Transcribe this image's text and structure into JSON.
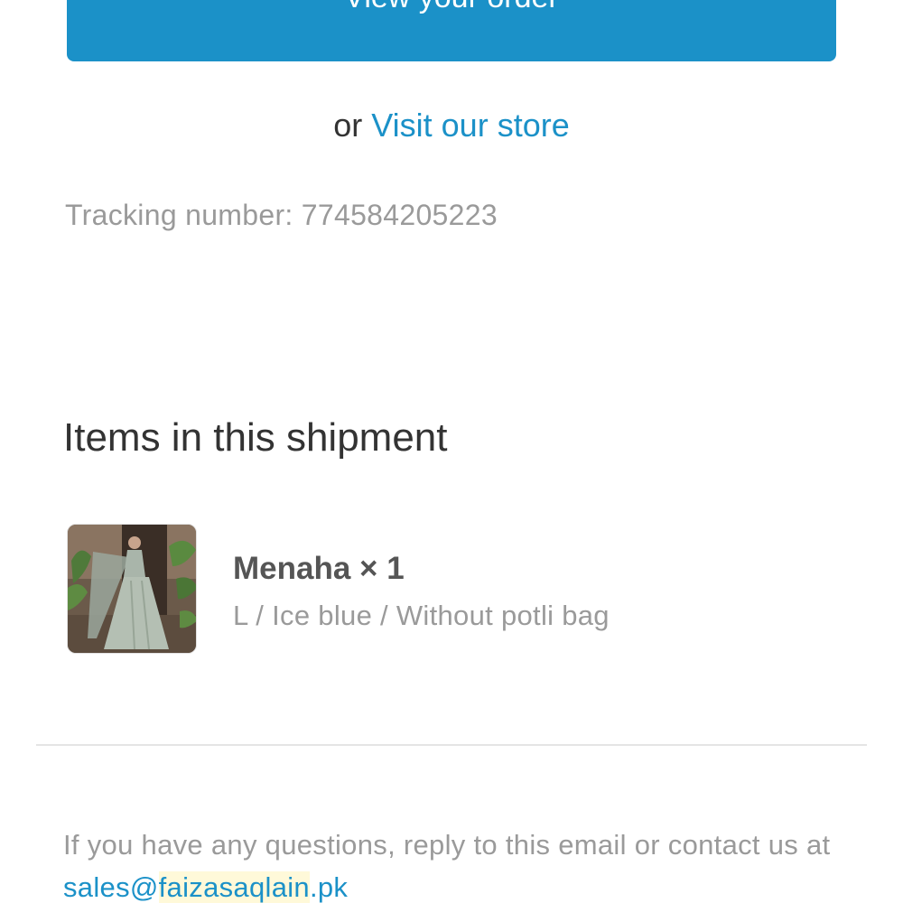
{
  "actions": {
    "view_order_label": "View your order",
    "or_text": "or",
    "visit_store_label": "Visit our store"
  },
  "tracking": {
    "text": "Tracking number: 774584205223"
  },
  "shipment": {
    "heading": "Items in this shipment",
    "items": [
      {
        "title": "Menaha × 1",
        "variant": "L / Ice blue / Without potli bag"
      }
    ]
  },
  "footer": {
    "text_before": "If you have any questions, reply to this email or contact us at",
    "email_part1": "sales@",
    "email_part2": "faizasaqlain",
    "email_part3": ".pk"
  },
  "colors": {
    "accent": "#1b91c8",
    "muted_text": "#9a9a9a",
    "body_text": "#333333"
  }
}
